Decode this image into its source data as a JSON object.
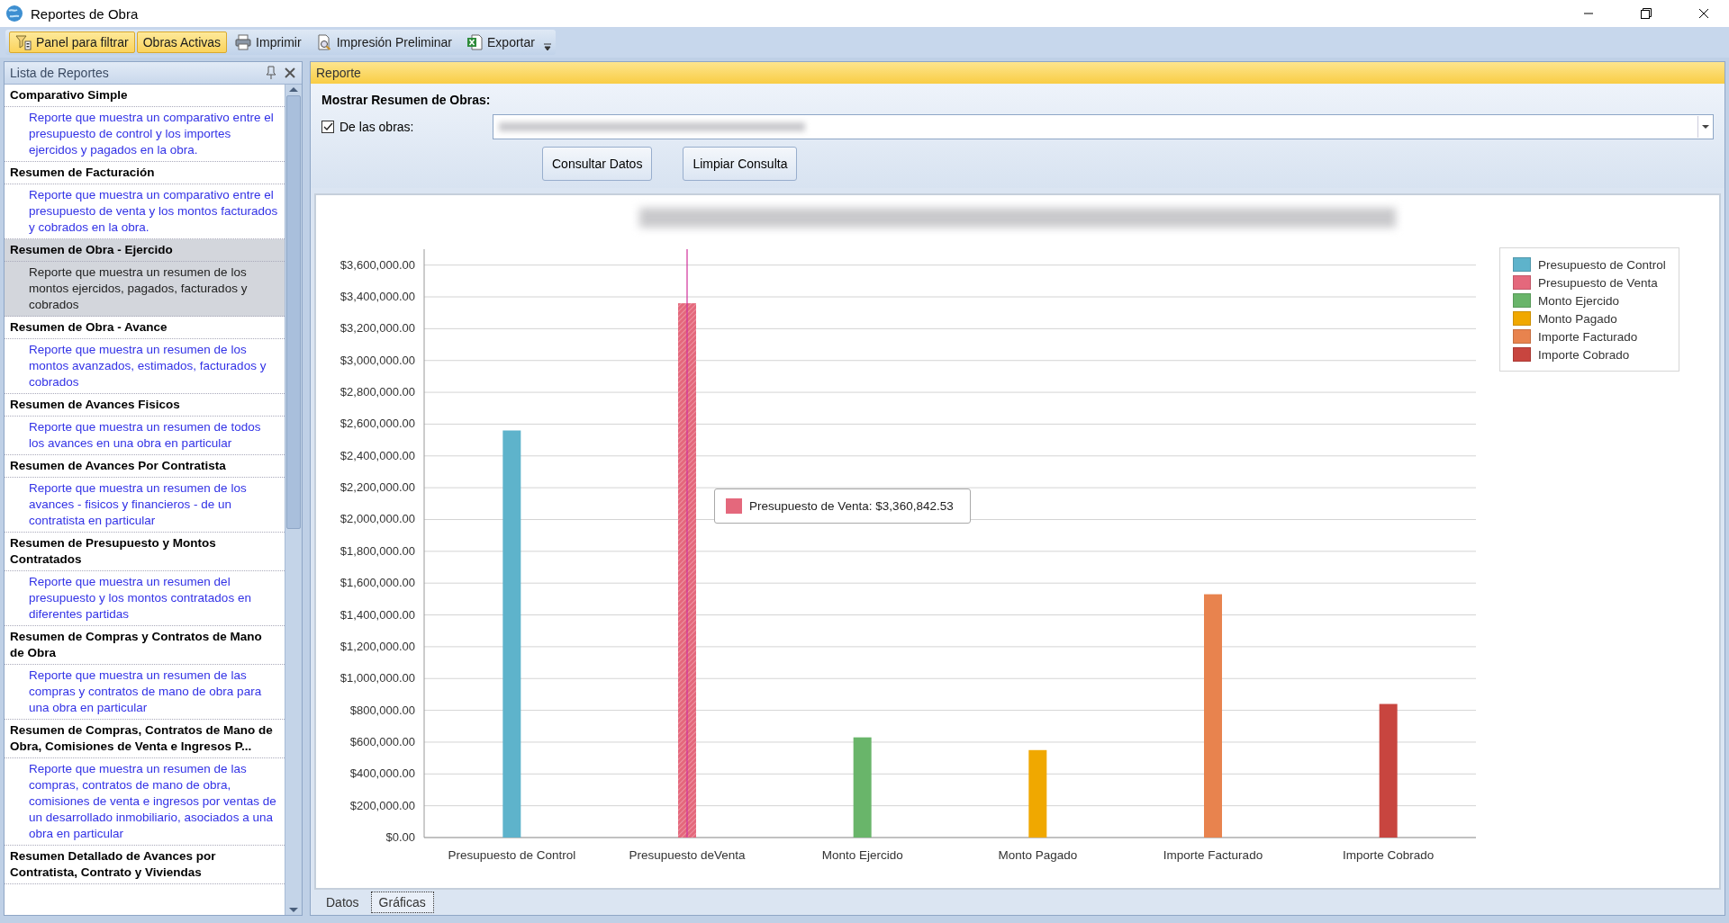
{
  "window": {
    "title": "Reportes de Obra"
  },
  "toolbar": [
    {
      "label": "Panel para filtrar",
      "kind": "filter",
      "checked": true
    },
    {
      "label": "Obras Activas",
      "kind": "plain",
      "checked": true
    },
    {
      "label": "Imprimir",
      "kind": "print",
      "checked": false
    },
    {
      "label": "Impresión Preliminar",
      "kind": "preview",
      "checked": false
    },
    {
      "label": "Exportar",
      "kind": "excel",
      "checked": false
    }
  ],
  "report_list": {
    "title": "Lista de Reportes",
    "items": [
      {
        "title": "Comparativo Simple",
        "description": "Reporte que muestra un comparativo entre el presupuesto de control y los importes ejercidos y pagados en la obra.",
        "selected": false
      },
      {
        "title": "Resumen de Facturación",
        "description": "Reporte que muestra un comparativo entre el presupuesto de venta y los montos facturados y cobrados en la obra.",
        "selected": false
      },
      {
        "title": "Resumen de Obra - Ejercido",
        "description": "Reporte que muestra un resumen de los montos ejercidos, pagados, facturados y cobrados",
        "selected": true
      },
      {
        "title": "Resumen de Obra - Avance",
        "description": "Reporte que muestra un resumen de los montos avanzados, estimados, facturados y cobrados",
        "selected": false
      },
      {
        "title": "Resumen de Avances Fisicos",
        "description": "Reporte que muestra un resumen de todos los avances en una obra en particular",
        "selected": false
      },
      {
        "title": "Resumen de Avances Por Contratista",
        "description": "Reporte que muestra un resumen de los avances - fisicos y financieros - de un contratista en particular",
        "selected": false
      },
      {
        "title": "Resumen de Presupuesto y Montos Contratados",
        "description": "Reporte que muestra un resumen del presupuesto y los montos contratados en diferentes partidas",
        "selected": false
      },
      {
        "title": "Resumen de Compras y Contratos de Mano de Obra",
        "description": "Reporte que muestra un resumen de las compras y contratos de mano de obra para una obra en particular",
        "selected": false
      },
      {
        "title": "Resumen de Compras, Contratos de Mano de Obra, Comisiones de Venta e Ingresos P...",
        "description": "Reporte que muestra un resumen de las compras, contratos de mano de obra, comisiones de venta e ingresos por ventas de un desarrollado inmobiliario, asociados a una obra en particular",
        "selected": false
      },
      {
        "title": "Resumen Detallado de Avances por Contratista, Contrato y Viviendas",
        "selected": false
      }
    ]
  },
  "report": {
    "title": "Reporte",
    "heading": "Mostrar Resumen de Obras:",
    "filter": {
      "label": "De las obras:",
      "checked": true
    },
    "buttons": [
      "Consultar Datos",
      "Limpiar Consulta"
    ],
    "chart": {
      "tooltip": {
        "text": "Presupuesto de Venta: $3,360,842.53",
        "color": "#e4687c"
      },
      "chart_data": {
        "type": "bar",
        "categories": [
          "Presupuesto de Control",
          "Presupuesto deVenta",
          "Monto Ejercido",
          "Monto Pagado",
          "Importe Facturado",
          "Importe Cobrado"
        ],
        "series": [
          {
            "name": "Presupuesto de Control",
            "color": "#5eb3cb",
            "values": [
              2560000,
              null,
              null,
              null,
              null,
              null
            ]
          },
          {
            "name": "Presupuesto de Venta",
            "color": "#e4687c",
            "values": [
              null,
              3360000,
              null,
              null,
              null,
              null
            ]
          },
          {
            "name": "Monto Ejercido",
            "color": "#69b56a",
            "values": [
              null,
              null,
              630000,
              null,
              null,
              null
            ]
          },
          {
            "name": "Monto Pagado",
            "color": "#f0a800",
            "values": [
              null,
              null,
              null,
              550000,
              null,
              null
            ]
          },
          {
            "name": "Importe Facturado",
            "color": "#e8834e",
            "values": [
              null,
              null,
              null,
              null,
              1530000,
              null
            ]
          },
          {
            "name": "Importe Cobrado",
            "color": "#c8453f",
            "values": [
              null,
              null,
              null,
              null,
              null,
              840000
            ]
          }
        ],
        "ylim": [
          0,
          3700000
        ],
        "grid": true,
        "ref_lines": [
          {
            "axis": "x",
            "value": "Presupuesto deVenta",
            "color": "#d0309a"
          }
        ],
        "yticks": [
          {
            "value": 0,
            "label": "$0.00"
          },
          {
            "value": 200000,
            "label": "$200,000.00"
          },
          {
            "value": 400000,
            "label": "$400,000.00"
          },
          {
            "value": 600000,
            "label": "$600,000.00"
          },
          {
            "value": 800000,
            "label": "$800,000.00"
          },
          {
            "value": 1000000,
            "label": "$1,000,000.00"
          },
          {
            "value": 1200000,
            "label": "$1,200,000.00"
          },
          {
            "value": 1400000,
            "label": "$1,400,000.00"
          },
          {
            "value": 1600000,
            "label": "$1,600,000.00"
          },
          {
            "value": 1800000,
            "label": "$1,800,000.00"
          },
          {
            "value": 2000000,
            "label": "$2,000,000.00"
          },
          {
            "value": 2200000,
            "label": "$2,200,000.00"
          },
          {
            "value": 2400000,
            "label": "$2,400,000.00"
          },
          {
            "value": 2600000,
            "label": "$2,600,000.00"
          },
          {
            "value": 2800000,
            "label": "$2,800,000.00"
          },
          {
            "value": 3000000,
            "label": "$3,000,000.00"
          },
          {
            "value": 3200000,
            "label": "$3,200,000.00"
          },
          {
            "value": 3400000,
            "label": "$3,400,000.00"
          },
          {
            "value": 3600000,
            "label": "$3,600,000.00"
          }
        ]
      }
    },
    "tabs": [
      {
        "label": "Datos",
        "selected": false
      },
      {
        "label": "Gráficas",
        "selected": true
      }
    ]
  }
}
